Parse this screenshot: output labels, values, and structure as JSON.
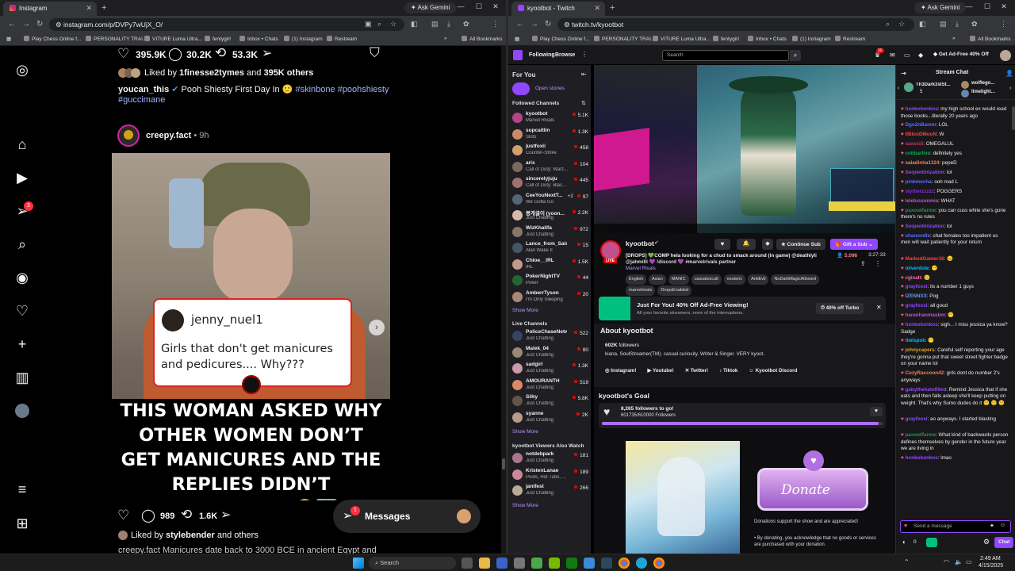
{
  "left_window": {
    "tab_title": "Instagram",
    "ask_gemini": "Ask Gemini",
    "url": "instagram.com/p/DVPy7wUjX_O/",
    "bookmarks": [
      "Play Chess Online f...",
      "PERSONALITY TRAI...",
      "VITURE Luma Ultra...",
      "fentygirl",
      "Inbox • Chats",
      "(1) Instagram",
      "Restream"
    ],
    "all_bookmarks": "All Bookmarks"
  },
  "instagram": {
    "post1": {
      "likes_count": "395.9K",
      "comments_count": "30.2K",
      "reposts_count": "53.3K",
      "liked_by_prefix": "Liked by ",
      "liked_by_user": "1finesse2tymes",
      "liked_by_mid": " and ",
      "liked_by_others": "395K others",
      "author": "youcan_this",
      "caption": " Pooh Shiesty First Day In ",
      "hashtags": "#skinbone #poohshiesty",
      "hashtag2": "#guccimane"
    },
    "post2": {
      "author": "creepy.fact",
      "time": "• 9h",
      "quote_user": "jenny_nuel1",
      "quote_text": "Girls that don't get manicures and pedicures.... Why???",
      "headline": "THIS WOMAN ASKED WHY OTHER WOMEN DON’T GET MANICURES AND THE REPLIES DIDN’T DISAPPOINT 🤣➡️",
      "comments_count": "989",
      "reposts_count": "1.6K",
      "liked_by_prefix": "Liked by ",
      "liked_by_user": "stylebender",
      "liked_by_suffix": " and others",
      "caption_partial": "creepy.fact Manicures date back to 3000 BCE in ancient Egypt and"
    },
    "notification_badge": "3",
    "messages_label": "Messages",
    "messages_badge": "1"
  },
  "right_window": {
    "tab_title": "kyootbot - Twitch",
    "ask_gemini": "Ask Gemini",
    "url": "twitch.tv/kyootbot",
    "bookmarks": [
      "Play Chess Online f...",
      "PERSONALITY TRAI...",
      "VITURE Luma Ultra...",
      "fentygirl",
      "Inbox • Chats",
      "(1) Instagram",
      "Restream"
    ],
    "all_bookmarks": "All Bookmarks"
  },
  "twitch": {
    "nav": {
      "following": "Following",
      "browse": "Browse",
      "search_placeholder": "Search",
      "notif_badge": "30",
      "ad_free": "Get Ad-Free 40% Off"
    },
    "sidebar": {
      "for_you": "For You",
      "open_stories": "Open stories",
      "followed_header": "Followed Channels",
      "followed": [
        {
          "name": "kyootbot",
          "game": "Marvel Rivals",
          "viewers": "5.1K",
          "color": "#b5458a"
        },
        {
          "name": "supcaitlin",
          "game": "Slots",
          "viewers": "1.3K",
          "color": "#c78a6a"
        },
        {
          "name": "justfoxii",
          "game": "Counter-Strike",
          "viewers": "458",
          "color": "#d0a070"
        },
        {
          "name": "aris",
          "game": "Call of Duty: Warz...",
          "viewers": "104",
          "color": "#7a6a5a"
        },
        {
          "name": "sincerelyjuju",
          "game": "Call of Duty: Blac...",
          "viewers": "445",
          "color": "#a07070"
        },
        {
          "name": "CeeYouNextT...",
          "game": "We Gotta Go",
          "viewers": "97",
          "extra": "+2",
          "color": "#556677"
        },
        {
          "name": "봉개굴이 (yoon...",
          "game": "Just Chatting",
          "viewers": "2.2K",
          "color": "#d8b8a8"
        },
        {
          "name": "WizKhalifa",
          "game": "Just Chatting",
          "viewers": "972",
          "color": "#887766"
        },
        {
          "name": "Lance_from_Saints",
          "game": "Alan Wake II",
          "viewers": "15",
          "color": "#445566"
        },
        {
          "name": "Chloe__IRL",
          "game": "IRL",
          "viewers": "1.5K",
          "color": "#c49a8a"
        },
        {
          "name": "PokerNightTV",
          "game": "Poker",
          "viewers": "44",
          "color": "#226633"
        },
        {
          "name": "AmberrTyson",
          "game": "I'm Only Sleeping",
          "viewers": "20",
          "color": "#aa8877"
        }
      ],
      "show_more": "Show More",
      "live_header": "Live Channels",
      "live": [
        {
          "name": "PoliceChaseNetw...",
          "game": "Just Chatting",
          "viewers": "522",
          "color": "#334466"
        },
        {
          "name": "Malek_04",
          "game": "Just Chatting",
          "viewers": "80",
          "color": "#998877"
        },
        {
          "name": "sadgirl",
          "game": "Just Chatting",
          "viewers": "1.3K",
          "color": "#cc99aa"
        },
        {
          "name": "AMOURANTH",
          "game": "Just Chatting",
          "viewers": "519",
          "color": "#dd8866"
        },
        {
          "name": "Silky",
          "game": "Just Chatting",
          "viewers": "5.8K",
          "color": "#665544"
        },
        {
          "name": "syanne",
          "game": "Just Chatting",
          "viewers": "2K",
          "color": "#bb9988"
        }
      ],
      "also_header": "kyootbot Viewers Also Watch",
      "also": [
        {
          "name": "notdebpark",
          "game": "Just Chatting",
          "viewers": "181",
          "color": "#aa7788"
        },
        {
          "name": "KristenLanae",
          "game": "Pools, Hot Tubs, ...",
          "viewers": "189",
          "color": "#cc8899"
        },
        {
          "name": "janifest",
          "game": "Just Chatting",
          "viewers": "266",
          "color": "#bbaa99"
        }
      ]
    },
    "stream": {
      "channel": "kyootbot",
      "title_line1": "[DROPS] 💚COMP hela looking for a chud to smack around (in game) @deathlyli",
      "title_line2": "@jahmilll 💜 !discord 💜 #marvelrivals partner",
      "game": "Marvel Rivals",
      "tags": [
        "English",
        "Asian",
        "MANIC",
        "casualoccult",
        "esoteric",
        "AntiEvil",
        "NoDarkMagicAllowed",
        "marvelrivals",
        "DropsEnabled"
      ],
      "viewers": "5,096",
      "uptime": "3:27:33",
      "live_badge": "LIVE",
      "continue_sub": "Continue Sub",
      "gift_sub": "Gift a Sub",
      "promo_title": "Just For You! 40% Off Ad-Free Viewing!",
      "promo_text": "All your favorite streamers, none of the interruptions.",
      "promo_button": "40% off Turbo",
      "about_title": "About kyootbot",
      "followers": "602K",
      "followers_label": "followers",
      "bio": "kiana. SoulStreamer(TM). casual curiosity. Writer & Singer. VERY kyoot.",
      "links": [
        "Instagram!",
        "Youtube!",
        "Twitter!",
        "Tiktok",
        "Kyootbot Discord"
      ],
      "goal_title": "kyootbot's Goal",
      "goal_text": "8,265 followers to go!",
      "goal_progress": "601735/610000 Followers",
      "goal_fraction": 0.9864,
      "donate_label": "Donate",
      "donate_text": "Donations support the show and are appreciated!",
      "donate_bullet": "By donating, you acknowledge that no goods or services are purchased with your donation."
    },
    "chat": {
      "header": "Stream Chat",
      "pinned": [
        {
          "name": "Th3Dark3stSt...",
          "count": "5"
        },
        {
          "name": "wolflego...",
          "count": ""
        },
        {
          "name": "limelight...",
          "count": "1"
        }
      ],
      "messages": [
        {
          "user": "honkobonkos",
          "color": "#9147ff",
          "text": ": my high school ex would read those books...literally 20 years ago"
        },
        {
          "user": "Dgo2nBamm",
          "color": "#5b6bff",
          "text": ": LOL"
        },
        {
          "user": "0BlooDMooN",
          "color": "#ff4040",
          "text": ": W"
        },
        {
          "user": "saxxxiii",
          "color": "#cc3366",
          "text": ": OMEGALUL"
        },
        {
          "user": "cobbarlive",
          "color": "#00b050",
          "text": ": definitely yes"
        },
        {
          "user": "saladinha1324",
          "color": "#ff7f50",
          "text": ": pepeD"
        },
        {
          "user": "Serpentinization",
          "color": "#9147ff",
          "text": ": lol"
        },
        {
          "user": "pinkmocha",
          "color": "#5b6bff",
          "text": ": ooh mad L"
        },
        {
          "user": "slytherzzzzz",
          "color": "#8a2be2",
          "text": ": POGGERS"
        },
        {
          "user": "lelelussonmia",
          "color": "#ba55d3",
          "text": ": WHAT"
        },
        {
          "user": "paxowlfarme",
          "color": "#2e8b57",
          "text": ": you can cuss while she's gone there's no rules"
        },
        {
          "user": "Serpentinization",
          "color": "#9147ff",
          "text": ": lol"
        },
        {
          "user": "shanoodle",
          "color": "#5b6bff",
          "text": ": chat females too impatient us men will wait patiently for your return"
        },
        {
          "user": "MarkedGamer16",
          "color": "#ff4040",
          "text": ": 😐"
        },
        {
          "user": "oliverdule",
          "color": "#00c0ff",
          "text": ": 😶"
        },
        {
          "user": "cgisalt",
          "color": "#ff69b4",
          "text": ": 🙂"
        },
        {
          "user": "grayfoxxi",
          "color": "#9147ff",
          "text": ": its a number 1 guys"
        },
        {
          "user": "IZENNXX",
          "color": "#5b9bff",
          "text": ": Pog"
        },
        {
          "user": "grayfoxxi",
          "color": "#9147ff",
          "text": ": all good"
        },
        {
          "user": "haranhanmasbm",
          "color": "#ba55d3",
          "text": ": 😶"
        },
        {
          "user": "honkobonkos",
          "color": "#9147ff",
          "text": ": sigh... I miss jessica ya know? Sadge"
        },
        {
          "user": "tiwispok",
          "color": "#00c0ff",
          "text": ": 😶"
        },
        {
          "user": "johnycapers",
          "color": "#daa520",
          "text": ": Careful self reporting your age they're gonna put that sweet street fighter badge on your name lol"
        },
        {
          "user": "CozyRaccoon42",
          "color": "#ff7f50",
          "text": ": girls dont do number 2's anyways"
        },
        {
          "user": "gabythehatefilled",
          "color": "#9147ff",
          "text": ": Remind Jessica that if she eats and then falls asleep she'll keep putting on weight. That's why Sumo dudes do it 😌 😌 😌"
        },
        {
          "user": "grayfoxxi",
          "color": "#9147ff",
          "text": ": ao anyways. I started blasting"
        },
        {
          "user": "paxowlfarme",
          "color": "#2e8b57",
          "text": ": What kind of backwards person defines themselves by gender in the future year we are living in"
        },
        {
          "user": "honkobonkos",
          "color": "#9147ff",
          "text": ": lmao"
        }
      ],
      "input_placeholder": "Send a message",
      "points": "0",
      "chat_button": "Chat"
    }
  },
  "taskbar": {
    "search": "Search",
    "time": "2:49 AM",
    "date": "4/15/2025"
  }
}
